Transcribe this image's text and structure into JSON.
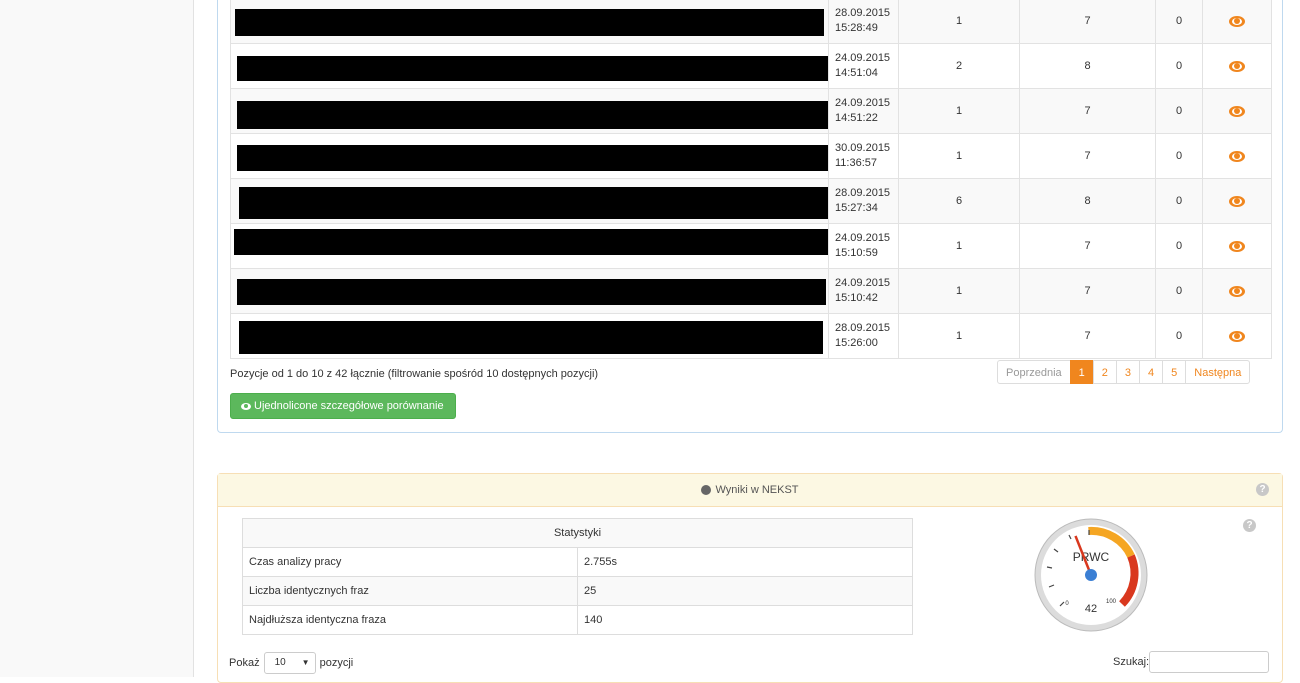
{
  "results": {
    "rows": [
      {
        "date": "28.09.2015",
        "time": "15:28:49",
        "c1": "1",
        "c2": "7",
        "c3": "0"
      },
      {
        "date": "24.09.2015",
        "time": "14:51:04",
        "c1": "2",
        "c2": "8",
        "c3": "0"
      },
      {
        "date": "24.09.2015",
        "time": "14:51:22",
        "c1": "1",
        "c2": "7",
        "c3": "0"
      },
      {
        "date": "30.09.2015",
        "time": "11:36:57",
        "c1": "1",
        "c2": "7",
        "c3": "0"
      },
      {
        "date": "28.09.2015",
        "time": "15:27:34",
        "c1": "6",
        "c2": "8",
        "c3": "0"
      },
      {
        "date": "24.09.2015",
        "time": "15:10:59",
        "c1": "1",
        "c2": "7",
        "c3": "0"
      },
      {
        "date": "24.09.2015",
        "time": "15:10:42",
        "c1": "1",
        "c2": "7",
        "c3": "0"
      },
      {
        "date": "28.09.2015",
        "time": "15:26:00",
        "c1": "1",
        "c2": "7",
        "c3": "0"
      }
    ],
    "info": "Pozycje od 1 do 10 z 42 łącznie (filtrowanie spośród 10 dostępnych pozycji)",
    "pagination": {
      "prev": "Poprzednia",
      "pages": [
        "1",
        "2",
        "3",
        "4",
        "5"
      ],
      "next": "Następna"
    },
    "compare_button": "Ujednolicone szczegółowe porównanie"
  },
  "nekst": {
    "heading": "Wyniki w NEKST",
    "help_icon": "?",
    "stats_title": "Statystyki",
    "stats": [
      {
        "label": "Czas analizy pracy",
        "value": "2.755s"
      },
      {
        "label": "Liczba identycznych fraz",
        "value": "25"
      },
      {
        "label": "Najdłuższa identyczna fraza",
        "value": "140"
      }
    ],
    "gauge": {
      "label": "PRWC",
      "value": 42,
      "min": "0",
      "max": "100",
      "value_text": "42"
    },
    "show_prefix": "Pokaż",
    "show_value": "10",
    "show_suffix": "pozycji",
    "search_label": "Szukaj:"
  },
  "colors": {
    "accent": "#f0861e",
    "success": "#5cb85c"
  }
}
